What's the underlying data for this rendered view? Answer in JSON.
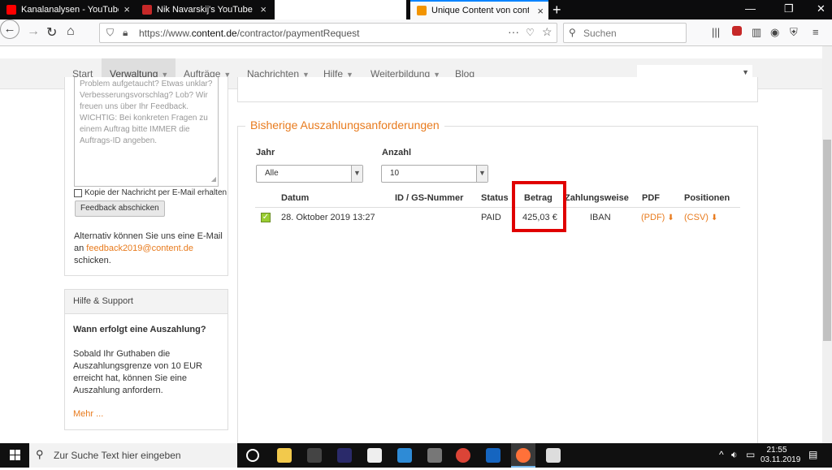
{
  "browser": {
    "tabs": [
      {
        "title": "Kanalanalysen - YouTube Studi",
        "active": false
      },
      {
        "title": "Nik Navarskij's YouTube Stats (",
        "active": false
      },
      {
        "title": "",
        "active": false
      },
      {
        "title": "Unique Content von content.de",
        "active": true
      }
    ],
    "url_prefix": "https://www.",
    "url_domain": "content.de",
    "url_path": "/contractor/paymentRequest",
    "search_placeholder": "Suchen",
    "url_dots": "···"
  },
  "site_nav": {
    "items": [
      {
        "label": "Start"
      },
      {
        "label": "Verwaltung"
      },
      {
        "label": "Aufträge"
      },
      {
        "label": "Nachrichten"
      },
      {
        "label": "Hilfe"
      },
      {
        "label": "Weiterbildung"
      },
      {
        "label": "Blog"
      }
    ]
  },
  "feedback": {
    "textarea_lines": [
      "Problem aufgetaucht? Etwas unklar?",
      "Verbesserungsvorschlag? Lob? Wir",
      "freuen uns über Ihr Feedback.",
      "WICHTIG: Bei konkreten Fragen zu",
      "einem Auftrag bitte IMMER die",
      "Auftrags-ID angeben."
    ],
    "copy_label": "Kopie der Nachricht per E-Mail erhalten",
    "send_label": "Feedback abschicken",
    "alt_before": "Alternativ können Sie uns eine E-Mail an ",
    "alt_mail": "feedback2019@content.de",
    "alt_after": " schicken."
  },
  "help": {
    "header": "Hilfe & Support",
    "question": "Wann erfolgt eine Auszahlung?",
    "text": "Sobald Ihr Guthaben die Auszahlungsgrenze von 10 EUR erreicht hat, können Sie eine Auszahlung anfordern.",
    "more": "Mehr ..."
  },
  "payouts": {
    "legend": "Bisherige Auszahlungsanforderungen",
    "year_label": "Jahr",
    "year_value": "Alle",
    "count_label": "Anzahl",
    "count_value": "10",
    "columns": [
      "Datum",
      "ID / GS-Nummer",
      "Status",
      "Betrag",
      "Zahlungsweise",
      "PDF",
      "Positionen"
    ],
    "rows": [
      {
        "date": "28. Oktober 2019 13:27",
        "id": "",
        "status": "PAID",
        "amount": "425,03 €",
        "method": "IBAN",
        "pdf": "(PDF)",
        "positions": "(CSV)"
      }
    ],
    "highlight_color": "#e00000",
    "accent_color": "#e87b1e"
  },
  "taskbar": {
    "search_placeholder": "Zur Suche Text hier eingeben",
    "time": "21:55",
    "date": "03.11.2019"
  },
  "icons": {
    "back": "←",
    "forward": "→",
    "reload": "↻",
    "home": "⌂",
    "search": "⚲",
    "star": "☆",
    "download": "⬇",
    "check": "✓"
  }
}
